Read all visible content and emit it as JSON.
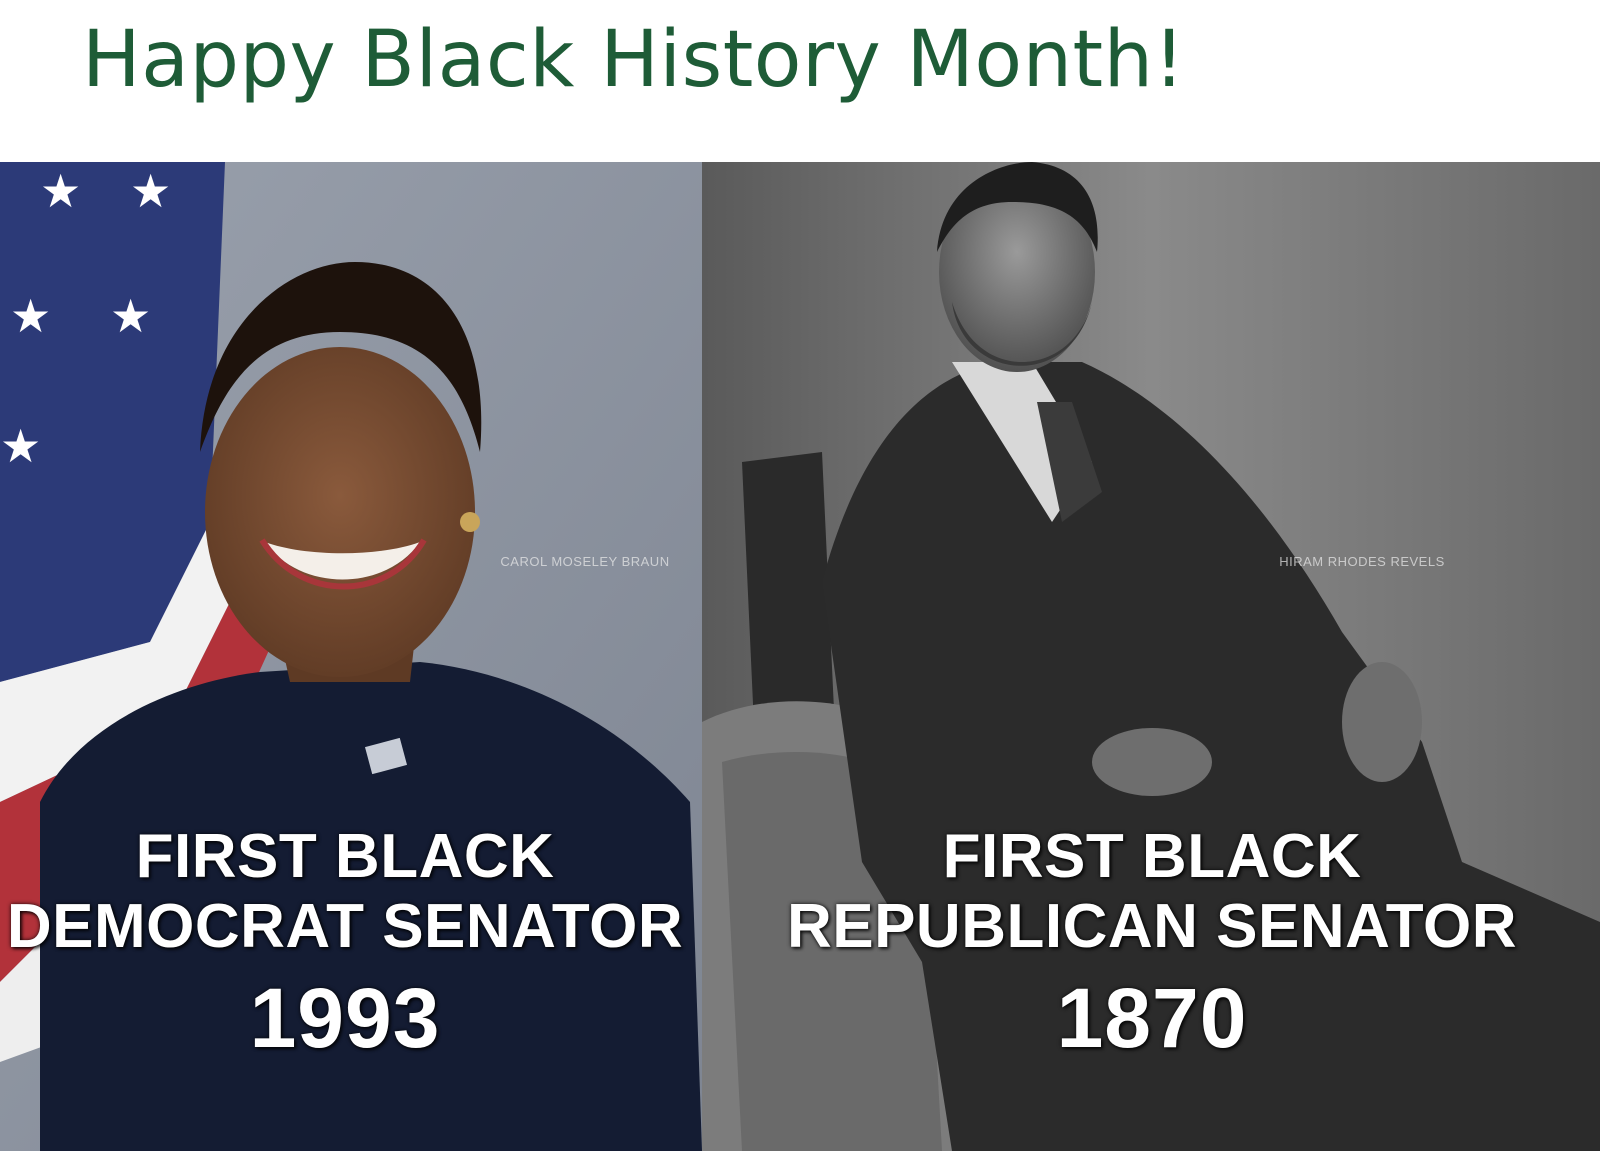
{
  "post": {
    "headline": "Happy Black History Month!",
    "headline_color": "#1e5c37"
  },
  "left_panel": {
    "subject_name_label": "CAROL MOSELEY BRAUN",
    "caption_line1": "FIRST BLACK",
    "caption_line2": "DEMOCRAT SENATOR",
    "caption_year": "1993",
    "photo_style": "color portrait with flag backdrop"
  },
  "right_panel": {
    "subject_name_label": "HIRAM RHODES REVELS",
    "caption_line1": "FIRST BLACK",
    "caption_line2": "REPUBLICAN SENATOR",
    "caption_year": "1870",
    "photo_style": "black-and-white seated portrait"
  },
  "colors": {
    "caption_text": "#ffffff",
    "left_backdrop": "#8e96a3",
    "flag_blue": "#2c3a78",
    "flag_red": "#b2323a",
    "jacket_navy": "#141c33",
    "right_backdrop": "#6e6e6e"
  }
}
